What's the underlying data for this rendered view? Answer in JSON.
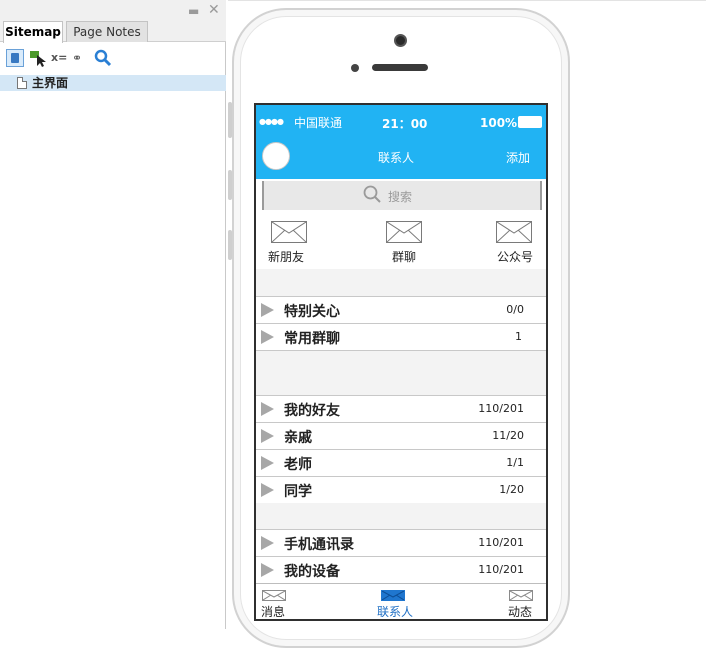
{
  "panel": {
    "tabs": [
      "Sitemap",
      "Page Notes"
    ],
    "toolbar": {
      "var_label": "x=",
      "link_label": "⚭"
    },
    "tree": [
      {
        "label": "主界面"
      }
    ]
  },
  "phone": {
    "status": {
      "carrier": "中国联通",
      "time": "21：00",
      "battery": "100%"
    },
    "header": {
      "title": "联系人",
      "action": "添加"
    },
    "search": {
      "placeholder": "搜索"
    },
    "quick_entries": [
      {
        "label": "新朋友",
        "icon": "envelope-icon"
      },
      {
        "label": "群聊",
        "icon": "envelope-icon"
      },
      {
        "label": "公众号",
        "icon": "envelope-icon"
      }
    ],
    "groups": [
      {
        "name": "特别关心",
        "count": "0/0"
      },
      {
        "name": "常用群聊",
        "count": "1"
      },
      {
        "name": "我的好友",
        "count": "110/201"
      },
      {
        "name": "亲戚",
        "count": "11/20"
      },
      {
        "name": "老师",
        "count": "1/1"
      },
      {
        "name": "同学",
        "count": "1/20"
      },
      {
        "name": "手机通讯录",
        "count": "110/201"
      },
      {
        "name": "我的设备",
        "count": "110/201"
      }
    ],
    "tabbar": [
      {
        "label": "消息",
        "active": false
      },
      {
        "label": "联系人",
        "active": true
      },
      {
        "label": "动态",
        "active": false
      }
    ]
  },
  "colors": {
    "header_bg": "#21b3f3",
    "active_tab": "#1f76cf",
    "tree_selected": "#d4e7f6"
  }
}
